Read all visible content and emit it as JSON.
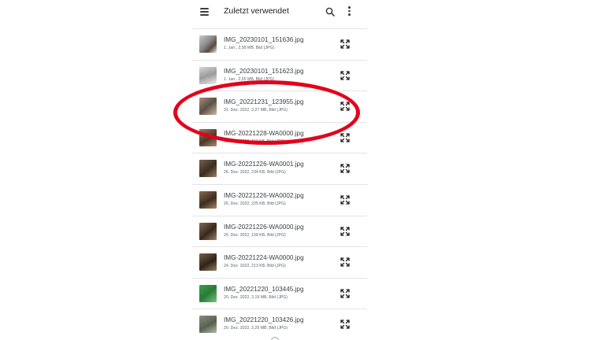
{
  "appbar": {
    "title": "Zuletzt verwendet",
    "menu_icon": "menu-icon",
    "search_icon": "search-icon",
    "more_icon": "more-vert-icon"
  },
  "files": [
    {
      "name": "IMG_20230101_151636.jpg",
      "meta": "1. Jan., 2,99 MB, Bild (JPG)"
    },
    {
      "name": "IMG_20230101_151623.jpg",
      "meta": "1. Jan., 2,55 MB, Bild (JPG)"
    },
    {
      "name": "IMG_20221231_123955.jpg",
      "meta": "31. Dez. 2022, 2,27 MB, Bild (JPG)"
    },
    {
      "name": "IMG-20221228-WA0000.jpg",
      "meta": "28. Dez. 2022, 117 KB, Bild (JPG)"
    },
    {
      "name": "IMG-20221226-WA0001.jpg",
      "meta": "26. Dez. 2022, 234 KB, Bild (JPG)"
    },
    {
      "name": "IMG-20221226-WA0002.jpg",
      "meta": "26. Dez. 2022, 225 KB, Bild (JPG)"
    },
    {
      "name": "IMG-20221226-WA0000.jpg",
      "meta": "26. Dez. 2022, 158 KB, Bild (JPG)"
    },
    {
      "name": "IMG-20221224-WA0000.jpg",
      "meta": "24. Dez. 2022, 213 KB, Bild (JPG)"
    },
    {
      "name": "IMG_20221220_103445.jpg",
      "meta": "20. Dez. 2022, 2,19 MB, Bild (JPG)"
    },
    {
      "name": "IMG_20221220_103426.jpg",
      "meta": "20. Dez. 2022, 2,29 MB, Bild (JPG)"
    }
  ],
  "row_icon": "expand-icon",
  "annotation": {
    "color": "#e3001b",
    "highlighted_row": 2
  },
  "colors": {
    "text": "#202124",
    "secondary": "#5f6368",
    "divider": "#e4e4e4"
  }
}
